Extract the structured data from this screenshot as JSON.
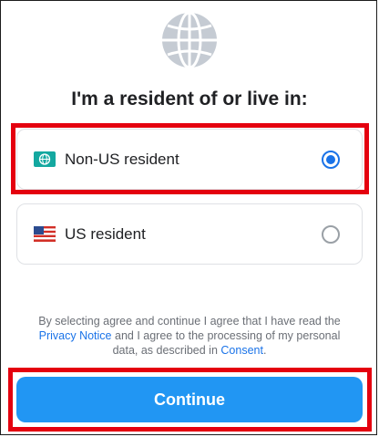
{
  "heading": "I'm a resident of or live in:",
  "options": [
    {
      "label": "Non-US resident",
      "icon": "globe-flag-icon",
      "selected": true
    },
    {
      "label": "US resident",
      "icon": "us-flag-icon",
      "selected": false
    }
  ],
  "consent": {
    "part1": "By selecting agree and continue I agree that I have read the ",
    "privacy_link": "Privacy Notice",
    "part2": " and I agree to the processing of my personal data, as described in ",
    "consent_link": "Consent",
    "part3": "."
  },
  "continue_label": "Continue",
  "colors": {
    "accent": "#1a73e8",
    "button": "#2196f3",
    "highlight": "#e4000f"
  }
}
